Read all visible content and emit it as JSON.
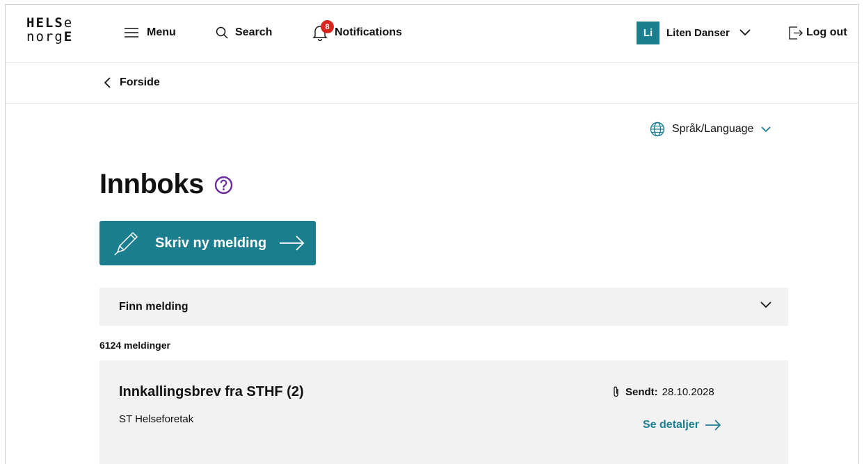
{
  "header": {
    "logo": {
      "line1": "HELSe",
      "line2": "norgE"
    },
    "menu_label": "Menu",
    "search_label": "Search",
    "notifications_label": "Notifications",
    "notifications_count": "8",
    "user_initials": "Li",
    "user_name": "Liten Danser",
    "logout_label": "Log out"
  },
  "breadcrumb": {
    "back_label": "Forside"
  },
  "language": {
    "label": "Språk/Language"
  },
  "page": {
    "title": "Innboks",
    "compose_label": "Skriv ny melding",
    "filter_label": "Finn melding",
    "message_count": "6124 meldinger"
  },
  "messages": [
    {
      "subject": "Innkallingsbrev fra STHF (2)",
      "sender": "ST Helseforetak",
      "sent_label": "Sendt:",
      "sent_date": "28.10.2028",
      "details_label": "Se detaljer",
      "has_attachment": true
    }
  ],
  "colors": {
    "accent": "#1b7e8f",
    "badge": "#d9261c",
    "help": "#6a2ba0",
    "panel": "#f3f2f2"
  },
  "icons": [
    "hamburger-icon",
    "search-icon",
    "bell-icon",
    "chevron-down-icon",
    "logout-icon",
    "chevron-left-icon",
    "globe-icon",
    "help-icon",
    "pencil-icon",
    "arrow-right-icon",
    "paperclip-icon"
  ]
}
